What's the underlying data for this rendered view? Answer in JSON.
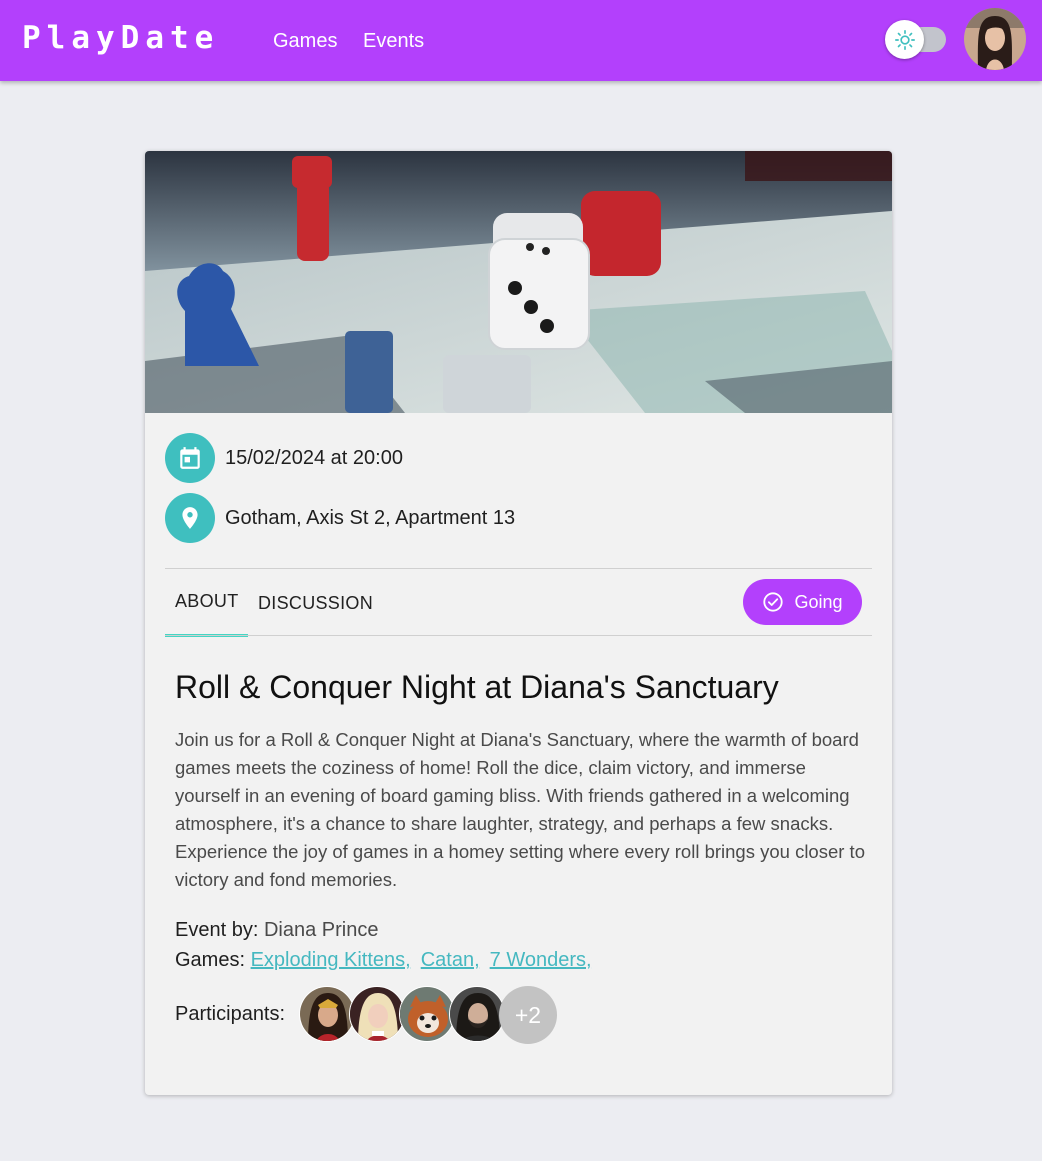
{
  "app": {
    "logo": "PlayDate"
  },
  "nav": {
    "links": [
      "Games",
      "Events"
    ]
  },
  "header": {
    "theme_toggle_icon": "sun-icon",
    "avatar_icon": "user-avatar"
  },
  "event": {
    "date": "15/02/2024 at 20:00",
    "location": "Gotham, Axis St 2, Apartment 13",
    "tabs": [
      "ABOUT",
      "DISCUSSION"
    ],
    "active_tab": "ABOUT",
    "going_label": "Going",
    "title": "Roll & Conquer Night at Diana's Sanctuary",
    "description": "Join us for a Roll & Conquer Night at Diana's Sanctuary, where the warmth of board games meets the coziness of home! Roll the dice, claim victory, and immerse yourself in an evening of board gaming bliss. With friends gathered in a welcoming atmosphere, it's a chance to share laughter, strategy, and perhaps a few snacks. Experience the joy of games in a homey setting where every roll brings you closer to victory and fond memories.",
    "host_label": "Event by:",
    "host_name": "Diana Prince",
    "games_label": "Games:",
    "games": [
      "Exploding Kittens,",
      "Catan,",
      "7 Wonders,"
    ],
    "participants_label": "Participants:",
    "participants_more": "+2"
  },
  "colors": {
    "brand": "#b340fc",
    "teal": "#3fbfbf",
    "indicator": "#45d6c4",
    "link": "#45b8c0"
  }
}
